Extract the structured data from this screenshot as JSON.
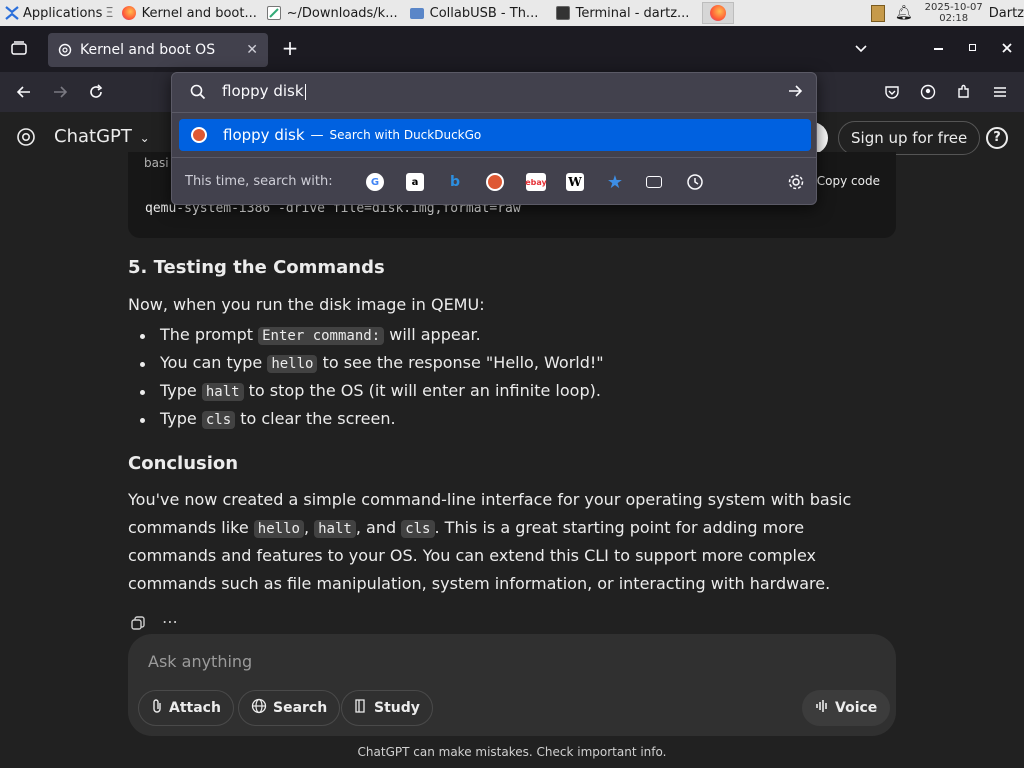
{
  "taskbar": {
    "apps_label": "Applications",
    "tasks": [
      {
        "label": "Kernel and boot..."
      },
      {
        "label": "~/Downloads/k..."
      },
      {
        "label": "CollabUSB - Th..."
      },
      {
        "label": "Terminal - dartz..."
      }
    ],
    "date": "2025-10-07",
    "time": "02:18",
    "user": "Dartz"
  },
  "browser": {
    "tab_title": "Kernel and boot OS",
    "url_input": "floppy disk",
    "suggestion": {
      "query": "floppy disk",
      "separator": "—",
      "action": "Search with DuckDuckGo"
    },
    "search_with_label": "This time, search with:",
    "engine_icons": [
      "google-icon",
      "amazon-icon",
      "bing-icon",
      "duckduckgo-icon",
      "ebay-icon",
      "wikipedia-icon",
      "bookmarks-icon",
      "tabs-icon",
      "history-icon"
    ],
    "accent": "#0061e0"
  },
  "site": {
    "name": "ChatGPT",
    "signup": "Sign up for free",
    "help": "?",
    "code_hint": "basi",
    "copy_code": "Copy code",
    "code_line": "qemu-system-i386 -drive file=disk.img,format=raw"
  },
  "article": {
    "section_heading": "5. Testing the Commands",
    "intro": "Now, when you run the disk image in QEMU:",
    "bullets": [
      {
        "pre": "The prompt ",
        "code": "Enter command:",
        "post": " will appear."
      },
      {
        "pre": "You can type ",
        "code": "hello",
        "post": " to see the response \"Hello, World!\""
      },
      {
        "pre": "Type ",
        "code": "halt",
        "post": " to stop the OS (it will enter an infinite loop)."
      },
      {
        "pre": "Type ",
        "code": "cls",
        "post": " to clear the screen."
      }
    ],
    "conclusion_heading": "Conclusion",
    "conclusion": {
      "line1": "You've now created a simple command-line interface for your operating system with basic",
      "line2_pre": "commands like ",
      "code1": "hello",
      "sep1": ", ",
      "code2": "halt",
      "sep2": ", and ",
      "code3": "cls",
      "line2_post": ". This is a great starting point for adding more",
      "line3": "commands and features to your OS. You can extend this CLI to support more complex",
      "line4": "commands such as file manipulation, system information, or interacting with hardware."
    }
  },
  "composer": {
    "placeholder": "Ask anything",
    "attach": "Attach",
    "search": "Search",
    "study": "Study",
    "voice": "Voice"
  },
  "footer": "ChatGPT can make mistakes. Check important info."
}
